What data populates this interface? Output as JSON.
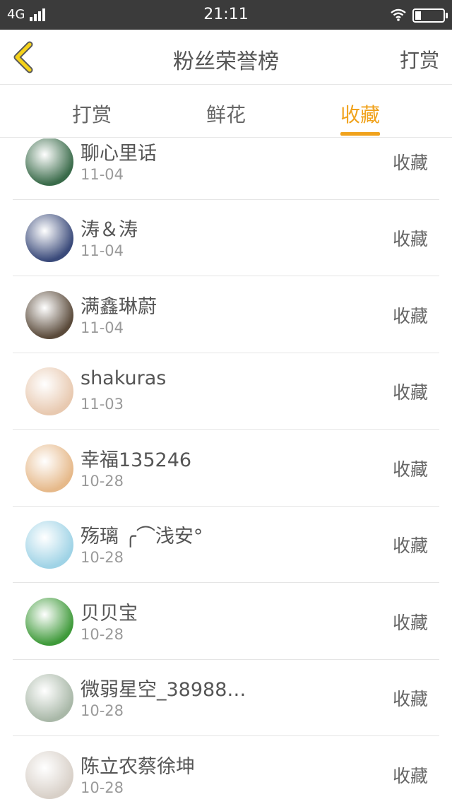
{
  "status_bar": {
    "network": "4G",
    "time": "21:11"
  },
  "header": {
    "back_icon": "chevron-left-icon",
    "title": "粉丝荣誉榜",
    "right_action": "打赏"
  },
  "tabs": [
    {
      "label": "打赏"
    },
    {
      "label": "鲜花"
    },
    {
      "label": "收藏"
    }
  ],
  "active_tab": "收藏",
  "accent_color": "#f0a21c",
  "fans": [
    {
      "name": "聊心里话",
      "date": "11-04",
      "action": "收藏",
      "avatar_color": "#3a6b4a"
    },
    {
      "name": "涛＆涛",
      "date": "11-04",
      "action": "收藏",
      "avatar_color": "#3a4a7a"
    },
    {
      "name": "满鑫琳蔚",
      "date": "11-04",
      "action": "收藏",
      "avatar_color": "#5a4a3a"
    },
    {
      "name": "shakuras",
      "date": "11-03",
      "action": "收藏",
      "avatar_color": "#e8c9b0"
    },
    {
      "name": "幸福135246",
      "date": "10-28",
      "action": "收藏",
      "avatar_color": "#e6b98a"
    },
    {
      "name": "殇璃  ╭⌒浅安°",
      "date": "10-28",
      "action": "收藏",
      "avatar_color": "#9fd3e6"
    },
    {
      "name": "贝贝宝",
      "date": "10-28",
      "action": "收藏",
      "avatar_color": "#3f9a3a"
    },
    {
      "name": "微弱星空_38988…",
      "date": "10-28",
      "action": "收藏",
      "avatar_color": "#a9b8a8"
    },
    {
      "name": "陈立农蔡徐坤",
      "date": "10-28",
      "action": "收藏",
      "avatar_color": "#d8d0c8"
    }
  ]
}
